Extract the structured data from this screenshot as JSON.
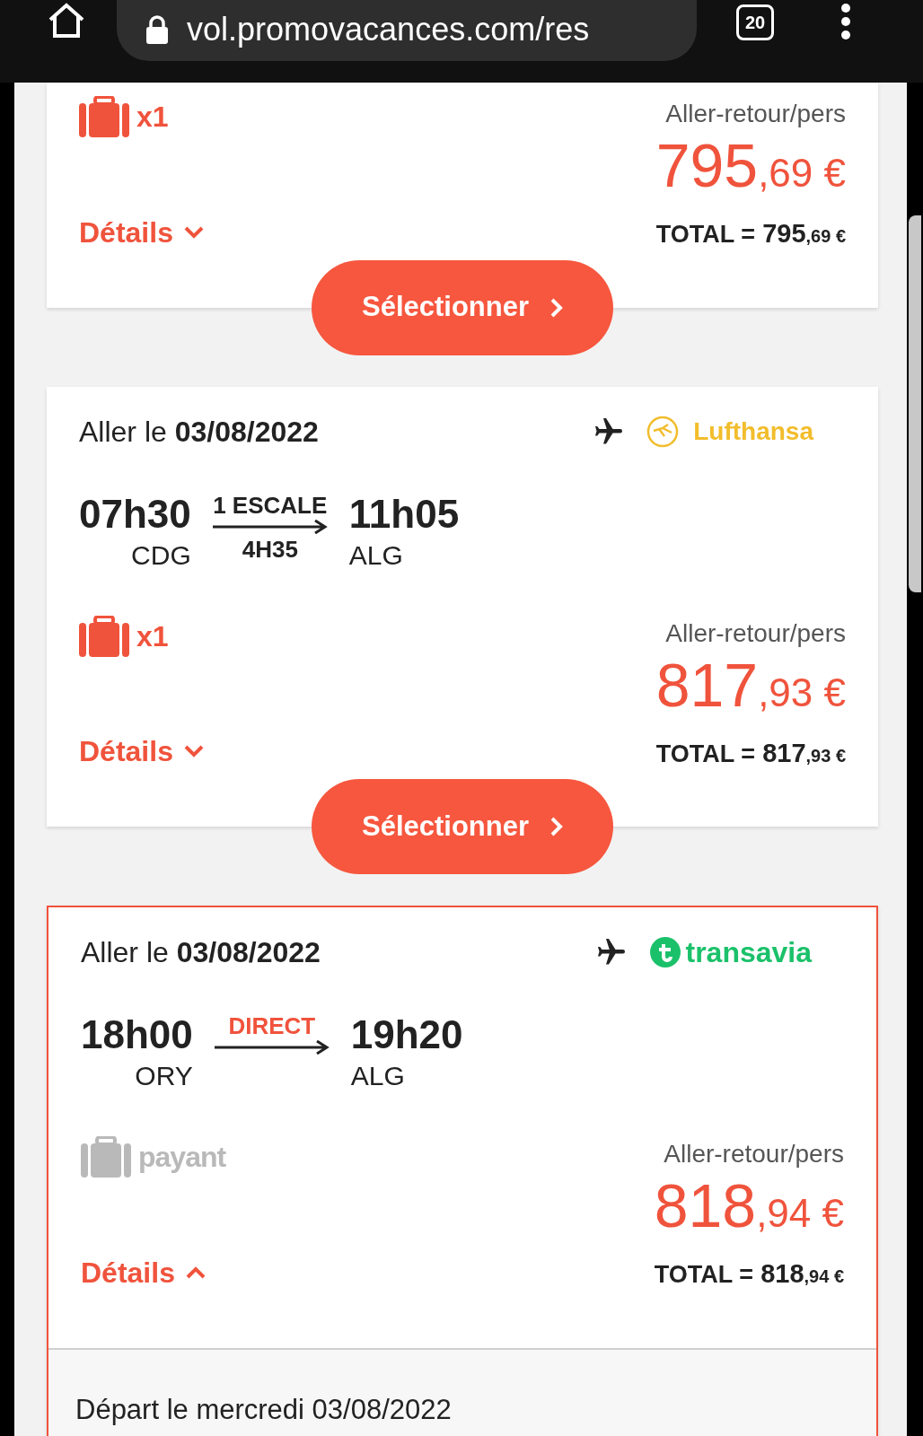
{
  "browser": {
    "url": "vol.promovacances.com/res",
    "tab_count": "20"
  },
  "flights": [
    {
      "selected": false,
      "baggage": {
        "kind": "included",
        "label": "x1"
      },
      "price_label": "Aller-retour/pers",
      "price_int": "795",
      "price_dec": ",69 €",
      "total_label": "TOTAL =",
      "total_int": "795",
      "total_dec": ",69 €",
      "details_label": "Détails",
      "details_expanded": false,
      "select_button": "Sélectionner"
    },
    {
      "selected": false,
      "date_prefix": "Aller le",
      "date": "03/08/2022",
      "airline": {
        "kind": "lufthansa",
        "name": "Lufthansa"
      },
      "depart_time": "07h30",
      "depart_airport": "CDG",
      "stops": {
        "kind": "stop",
        "label": "1 ESCALE"
      },
      "duration": "4H35",
      "arrive_time": "11h05",
      "arrive_airport": "ALG",
      "baggage": {
        "kind": "included",
        "label": "x1"
      },
      "price_label": "Aller-retour/pers",
      "price_int": "817",
      "price_dec": ",93 €",
      "total_label": "TOTAL =",
      "total_int": "817",
      "total_dec": ",93 €",
      "details_label": "Détails",
      "details_expanded": false,
      "select_button": "Sélectionner"
    },
    {
      "selected": true,
      "date_prefix": "Aller le",
      "date": "03/08/2022",
      "airline": {
        "kind": "transavia",
        "name": "transavia"
      },
      "depart_time": "18h00",
      "depart_airport": "ORY",
      "stops": {
        "kind": "direct",
        "label": "DIRECT"
      },
      "arrive_time": "19h20",
      "arrive_airport": "ALG",
      "baggage": {
        "kind": "paid",
        "label": "payant"
      },
      "price_label": "Aller-retour/pers",
      "price_int": "818",
      "price_dec": ",94 €",
      "total_label": "TOTAL =",
      "total_int": "818",
      "total_dec": ",94 €",
      "details_label": "Détails",
      "details_expanded": true,
      "details_text": "Départ le mercredi 03/08/2022"
    }
  ]
}
